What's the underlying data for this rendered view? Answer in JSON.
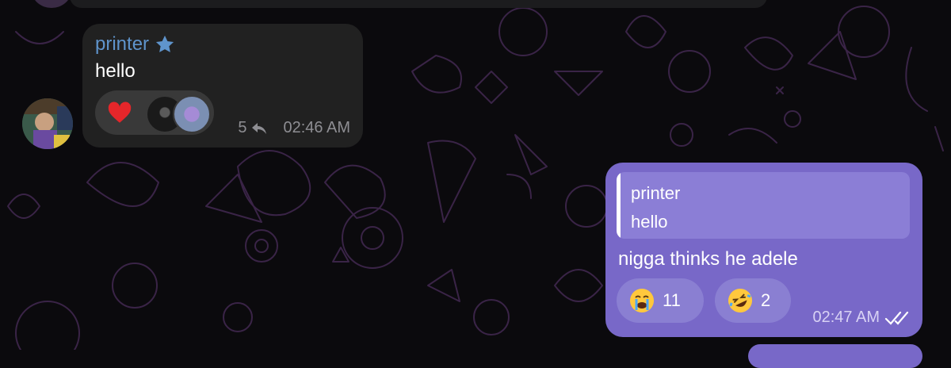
{
  "incoming": {
    "sender": "printer",
    "text": "hello",
    "reply_count": "5",
    "time": "02:46 AM",
    "icons": [
      "star-icon",
      "heart-icon",
      "reply-icon"
    ]
  },
  "outgoing": {
    "quote": {
      "name": "printer",
      "text": "hello"
    },
    "text": "nigga thinks he adele",
    "reactions": [
      {
        "emoji": "loudly-crying-face",
        "count": "11"
      },
      {
        "emoji": "rolling-on-floor-laughing",
        "count": "2"
      }
    ],
    "time": "02:47 AM",
    "status_icon": "double-check-icon"
  },
  "colors": {
    "background": "#0b0a0d",
    "incoming_bubble": "#212121",
    "outgoing_bubble": "#7868c8",
    "sender_name": "#5f94cc"
  }
}
